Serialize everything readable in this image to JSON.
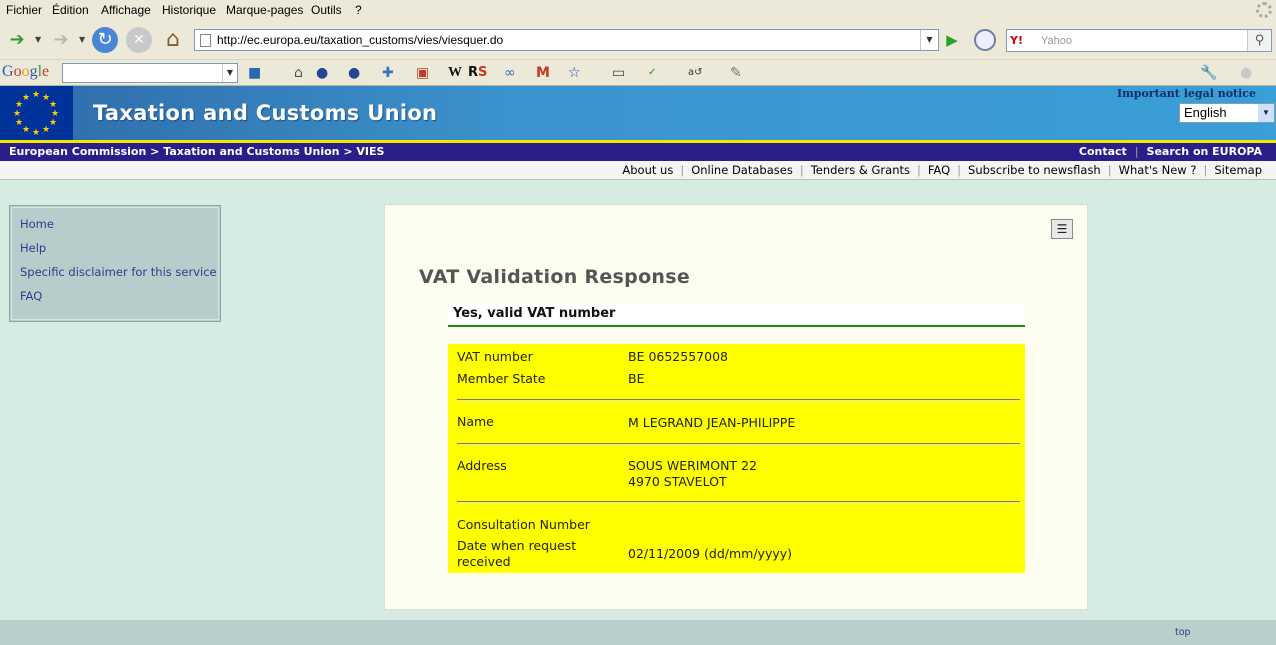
{
  "browser": {
    "menu": [
      "Fichier",
      "Édition",
      "Affichage",
      "Historique",
      "Marque-pages",
      "Outils",
      "?"
    ],
    "url": "http://ec.europa.eu/taxation_customs/vies/viesquer.do",
    "search_placeholder": "Yahoo",
    "search_engine_label": "Y!",
    "google_label": "Google"
  },
  "site": {
    "title": "Taxation and Customs Union",
    "legal_notice": "Important legal notice",
    "language": "English",
    "breadcrumb": [
      "European Commission",
      ">",
      "Taxation and Customs Union",
      ">",
      "VIES"
    ],
    "top_links": [
      "Contact",
      "Search on EUROPA"
    ],
    "nav_links": [
      "About us",
      "Online Databases",
      "Tenders & Grants",
      "FAQ",
      "Subscribe to newsflash",
      "What's New ?",
      "Sitemap"
    ]
  },
  "sidebar": {
    "items": [
      "Home",
      "Help",
      "Specific disclaimer for this service",
      "FAQ"
    ]
  },
  "main": {
    "title": "VAT Validation Response",
    "result": "Yes, valid VAT number",
    "rows": {
      "vat_label": "VAT number",
      "vat_value": "BE 0652557008",
      "member_label": "Member State",
      "member_value": "BE",
      "name_label": "Name",
      "name_value": "M LEGRAND JEAN-PHILIPPE",
      "address_label": "Address",
      "address_line1": "SOUS WERIMONT 22",
      "address_line2": "4970 STAVELOT",
      "consult_label": "Consultation Number",
      "consult_value": "",
      "date_label_1": "Date when request",
      "date_label_2": "received",
      "date_value": "02/11/2009 (dd/mm/yyyy)"
    }
  },
  "footer": {
    "top_link": "top"
  },
  "colors": {
    "result_bg": "#ffff00",
    "accent_green": "#1e8a1e",
    "banner_dark": "#2a1f8a",
    "page_bg": "#d6ebe1"
  }
}
